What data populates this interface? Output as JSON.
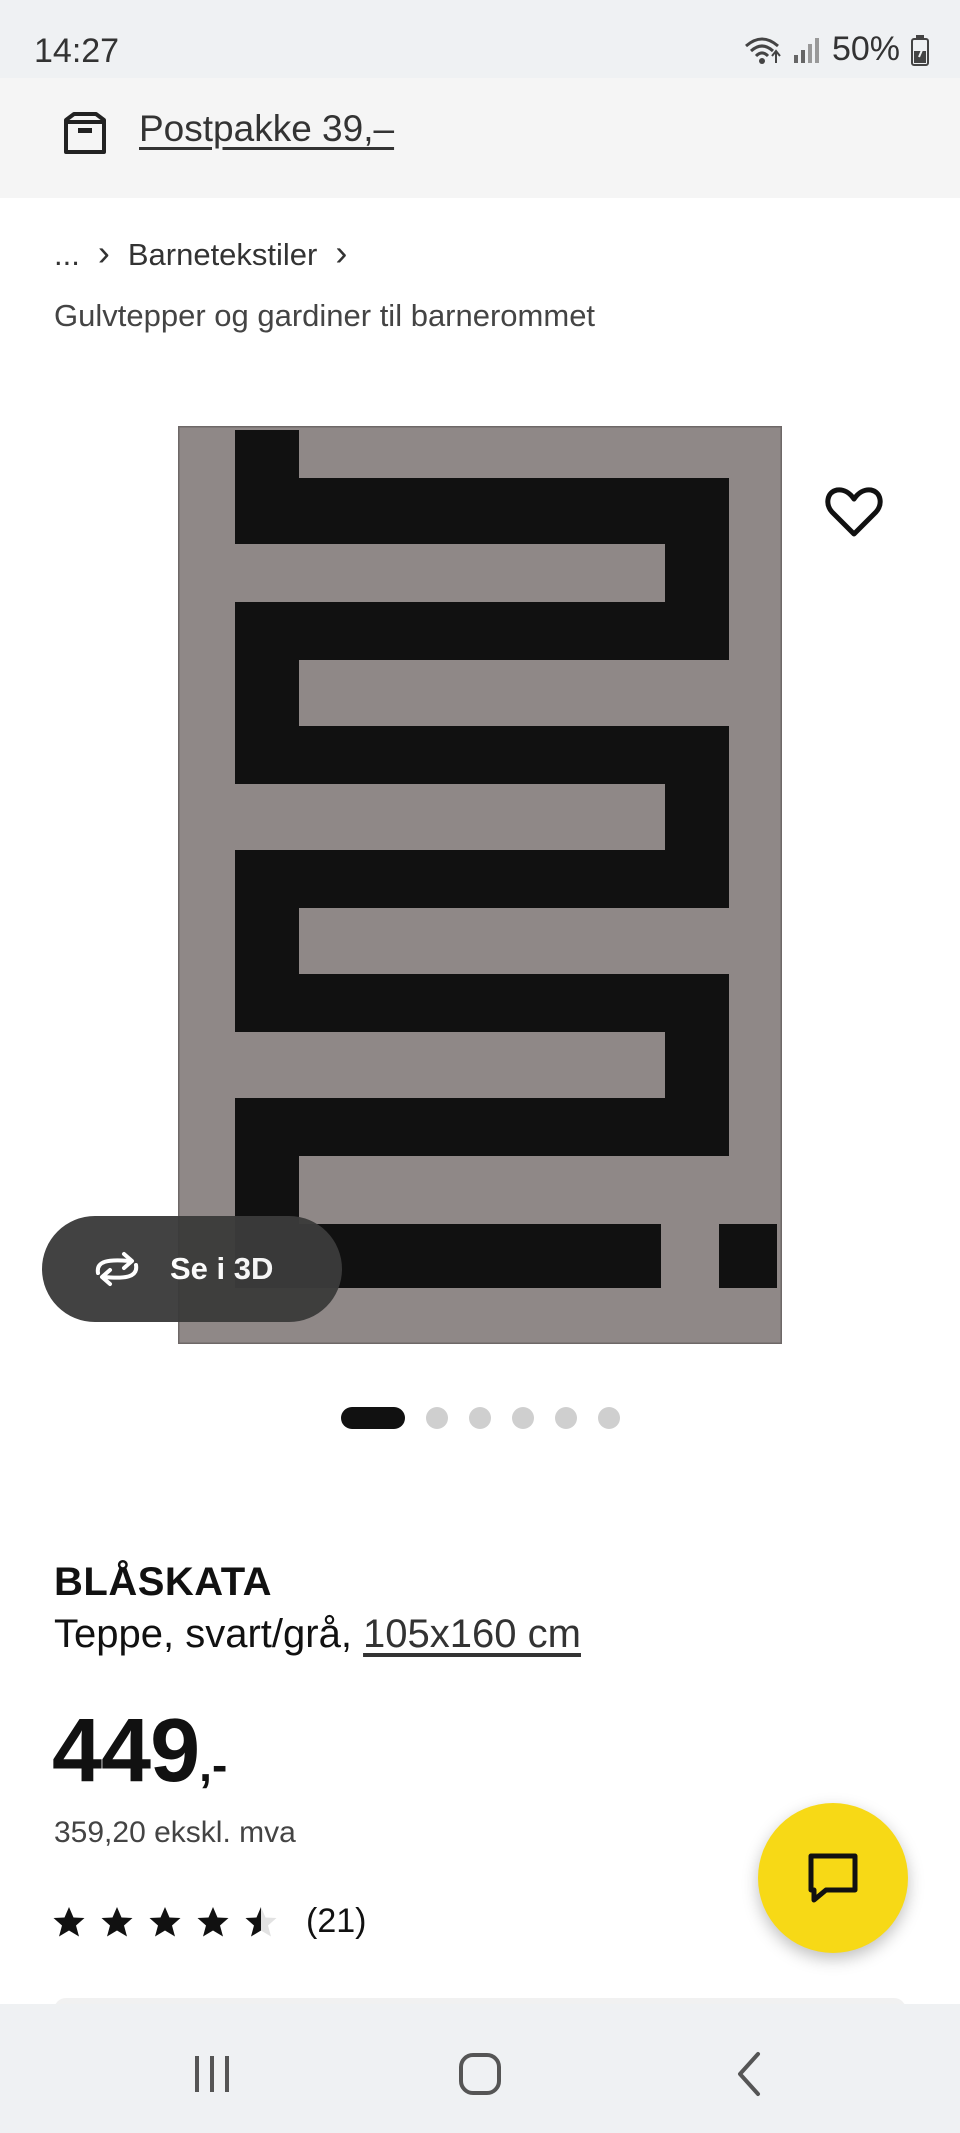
{
  "status_bar": {
    "time": "14:27",
    "battery": "50%"
  },
  "delivery": {
    "label": "Postpakke 39,–",
    "icon": "delivery-box-icon"
  },
  "breadcrumb": {
    "ellipsis": "...",
    "category": "Barnetekstiler",
    "subcategory": "Gulvtepper og gardiner til barnerommet"
  },
  "gallery": {
    "threed_label": "Se i 3D",
    "total_images": 6,
    "active_index": 0
  },
  "product": {
    "name": "BLÅSKATA",
    "description": "Teppe, svart/grå, ",
    "size": "105x160 cm",
    "price": "449",
    "price_suffix": ",-",
    "price_ex_vat": "359,20 ekskl. mva",
    "rating": 4.5,
    "rating_max": 5,
    "review_count": "(21)"
  },
  "colors": {
    "accent_yellow": "#f7d916",
    "rug_gray": "#8f8887",
    "rug_black": "#111111"
  },
  "icons": [
    "wifi-icon",
    "signal-icon",
    "battery-icon",
    "heart-icon",
    "rotate-3d-icon",
    "chat-icon",
    "star-icon",
    "recent-apps-icon",
    "home-icon",
    "back-icon"
  ]
}
